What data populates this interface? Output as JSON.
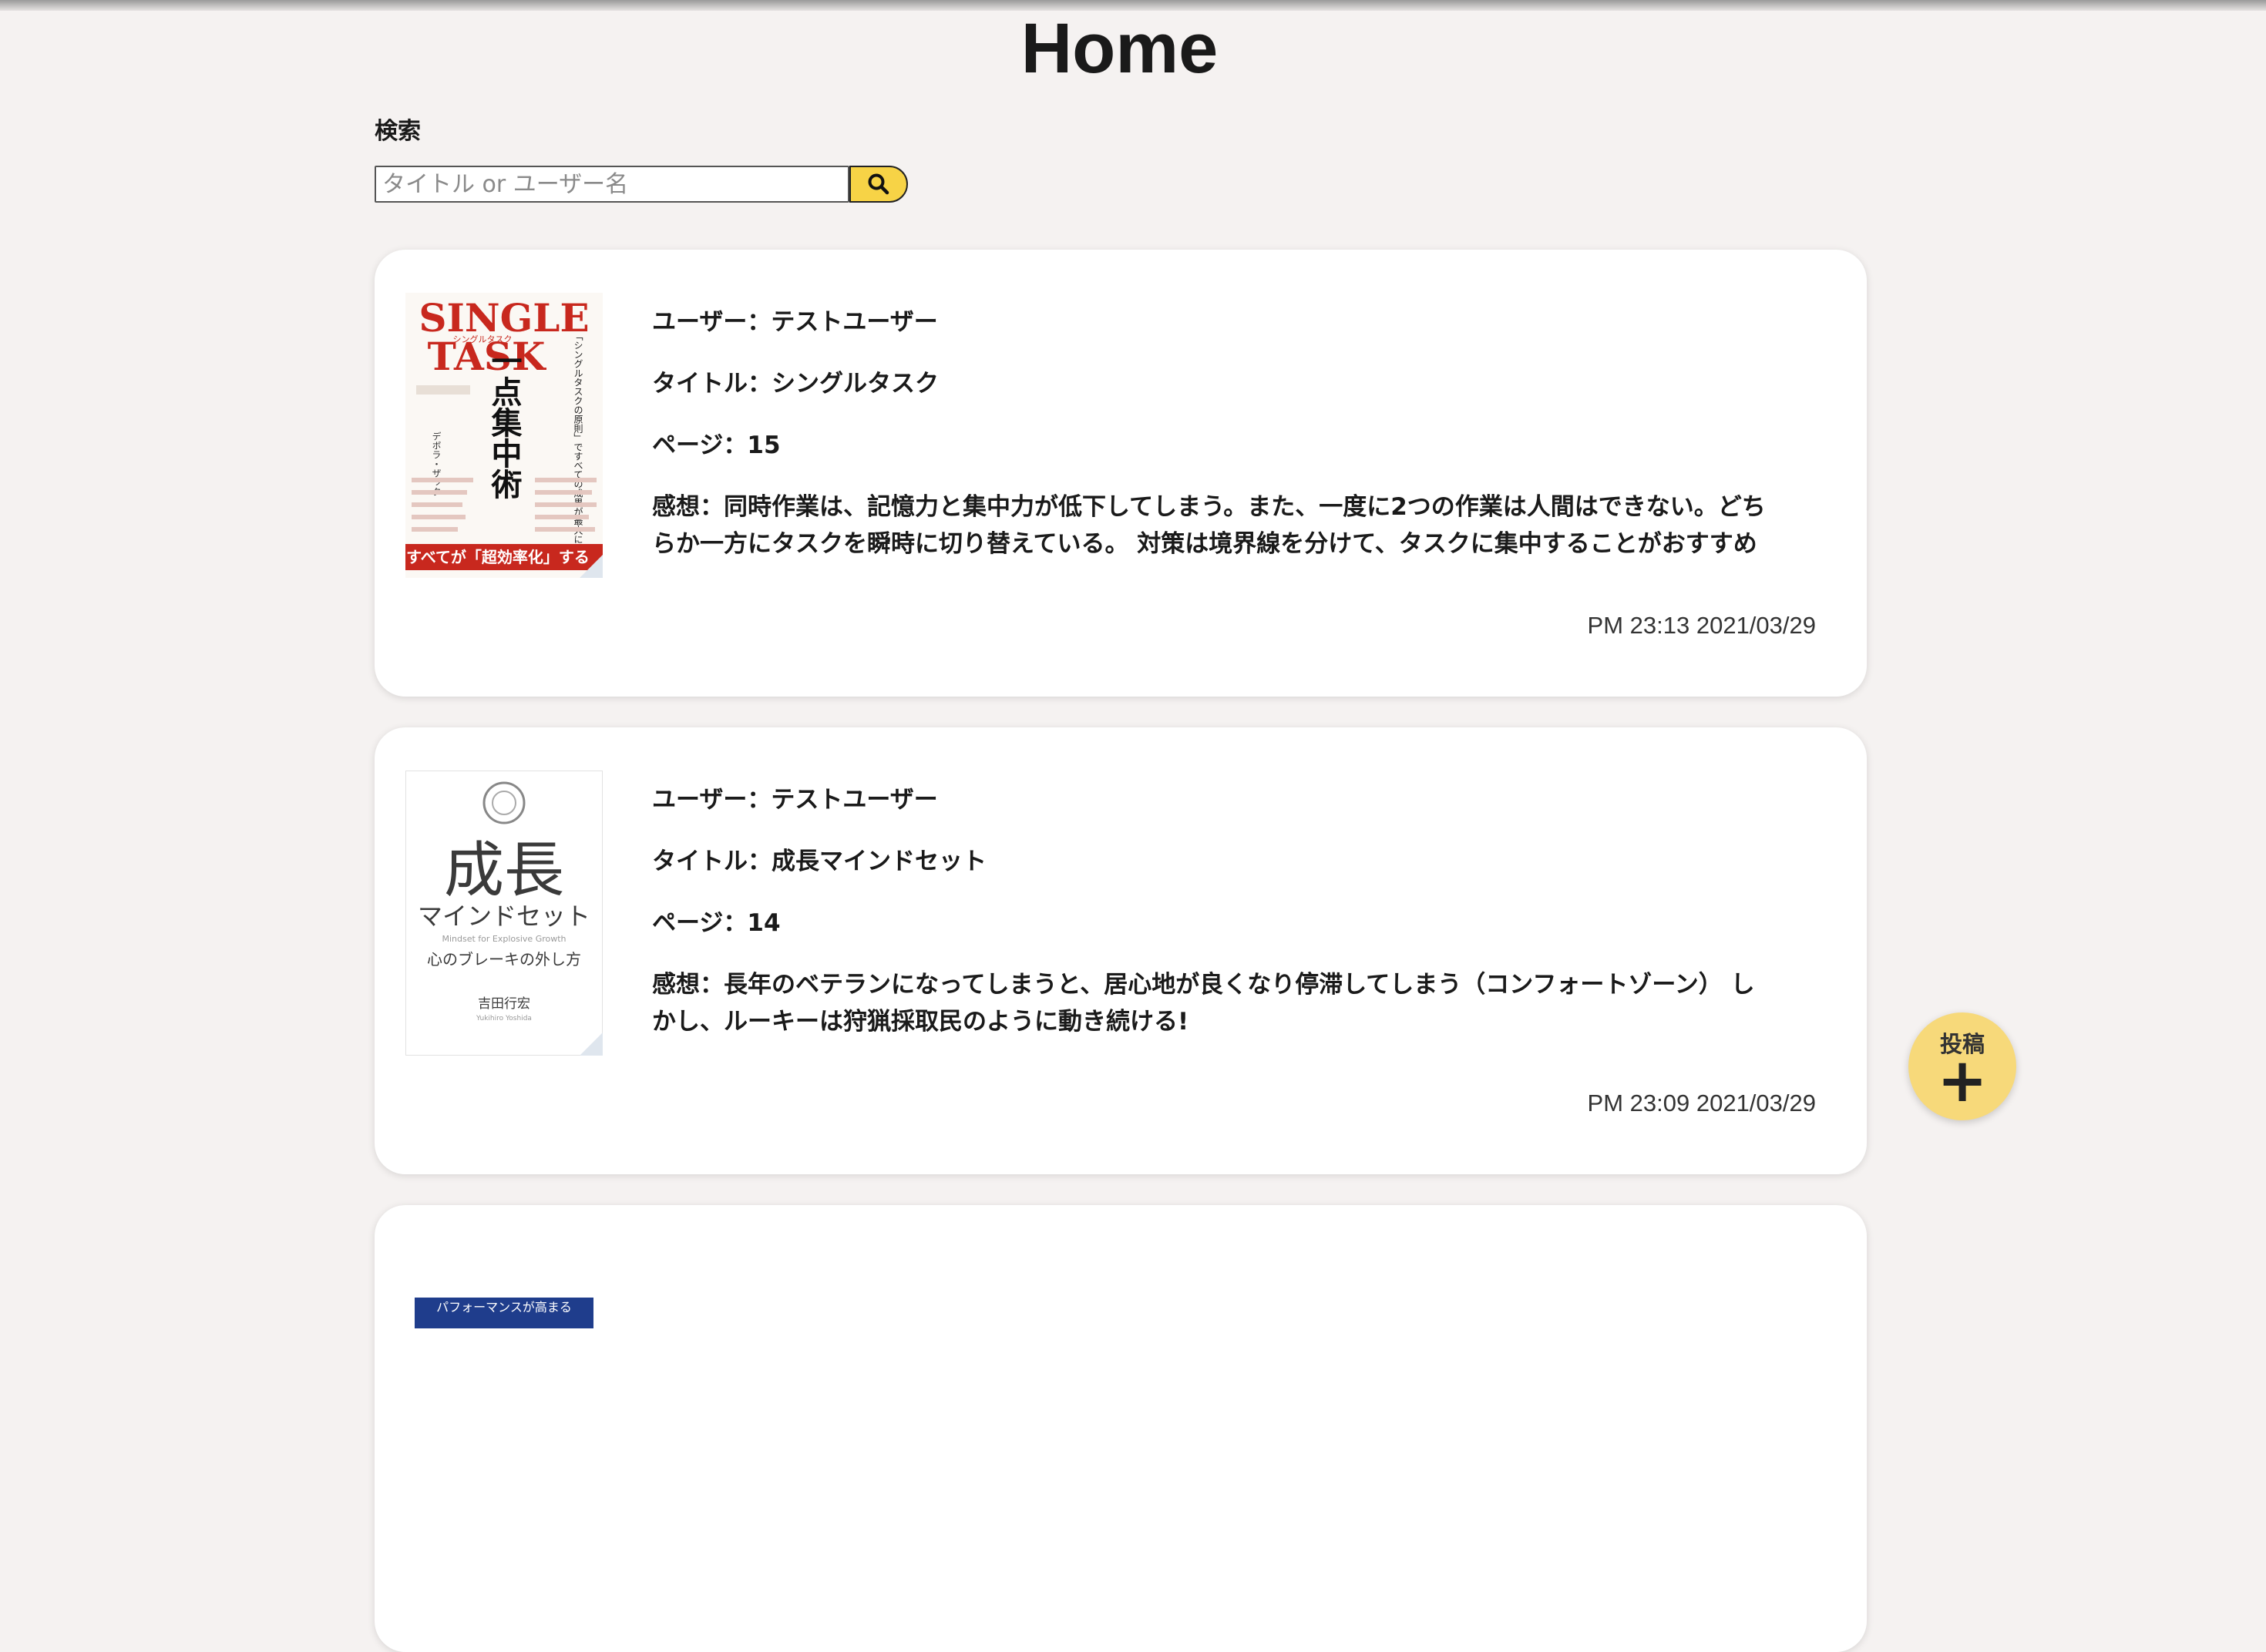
{
  "header": {
    "title": "Home"
  },
  "search": {
    "label": "検索",
    "placeholder": "タイトル or ユーザー名",
    "value": ""
  },
  "posts": [
    {
      "user": "ユーザー：テストユーザー",
      "title": "タイトル：シングルタスク",
      "pages": "ページ：15",
      "impression": "感想：同時作業は、記憶力と集中力が低下してしまう。また、一度に2つの作業は人間はできない。どちらか一方にタスクを瞬時に切り替えている。 対策は境界線を分けて、タスクに集中することがおすすめ",
      "timestamp": "PM 23:13 2021/03/29",
      "cover": {
        "title_line1": "SINGLE",
        "title_line2": "TASK",
        "ruby": "シングルタスク",
        "vertical_title": "一点集中術",
        "tagline": "「シングルタスクの原則」ですべての成果が最大になる",
        "band": "すべてが「超効率化」する",
        "author_block": "デボラ・ザック",
        "accent_color": "#c8281e"
      }
    },
    {
      "user": "ユーザー：テストユーザー",
      "title": "タイトル：成長マインドセット",
      "pages": "ページ：14",
      "impression": "感想：長年のベテランになってしまうと、居心地が良くなり停滞してしまう（コンフォートゾーン） しかし、ルーキーは狩猟採取民のように動き続ける!",
      "timestamp": "PM 23:09 2021/03/29",
      "cover": {
        "title_big": "成長",
        "title_sub": "マインドセット",
        "english": "Mindset for Explosive Growth",
        "subtitle": "心のブレーキの外し方",
        "author": "吉田行宏",
        "author_en": "Yukihiro Yoshida"
      }
    },
    {
      "cover": {
        "banner": "パフォーマンスが高まる"
      }
    }
  ],
  "fab": {
    "label": "投稿",
    "icon": "plus-icon"
  },
  "colors": {
    "background": "#f5f2f1",
    "accent_yellow": "#f7d346",
    "fab_yellow": "#f7d97a",
    "card": "#ffffff"
  }
}
